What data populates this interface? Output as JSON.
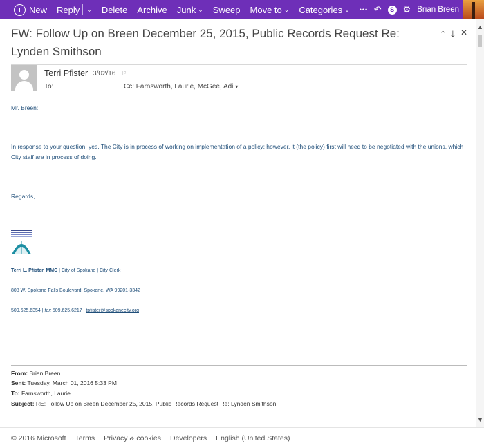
{
  "toolbar": {
    "new": "New",
    "reply": "Reply",
    "delete": "Delete",
    "archive": "Archive",
    "junk": "Junk",
    "sweep": "Sweep",
    "move_to": "Move to",
    "categories": "Categories",
    "more": "•••",
    "undo_icon": "↶",
    "settings_icon": "⚙",
    "user_name": "Brian Breen",
    "accent_color": "#6e2fb8"
  },
  "message": {
    "subject": "FW: Follow Up on Breen December 25, 2015, Public Records Request Re: Lynden Smithson",
    "sender": "Terri Pfister",
    "date": "3/02/16",
    "to_label": "To: ",
    "cc_label": "Cc: Farnsworth, Laurie, McGee, Adi",
    "salutation": "Mr. Breen:",
    "paragraph": "In response to your question, yes.  The City is in process of working on implementation of a policy; however, it (the policy) first will need to be negotiated with the unions, which City staff are in process of doing.",
    "regards": "Regards,",
    "signature": {
      "name": "Terri L. Pfister, MMC",
      "title": " | City of Spokane | City Clerk",
      "address": "808 W. Spokane Falls Boulevard, Spokane, WA  99201-3342",
      "phone": "509.625.6354 | ",
      "fax_label": "fax",
      "fax": " 509.625.6217 | ",
      "email": "tpfister@spokanecity.org"
    },
    "forwarded": {
      "from_label": "From:",
      "from": " Brian Breen",
      "sent_label": "Sent:",
      "sent": " Tuesday, March 01, 2016 5:33 PM",
      "to_label": "To:",
      "to": " Farnsworth, Laurie",
      "subject_label": "Subject:",
      "subject": " RE: Follow Up on Breen December 25, 2015, Public Records Request Re: Lynden Smithson"
    }
  },
  "footer": {
    "copyright": "© 2016 Microsoft",
    "terms": "Terms",
    "privacy": "Privacy & cookies",
    "developers": "Developers",
    "language": "English (United States)"
  }
}
